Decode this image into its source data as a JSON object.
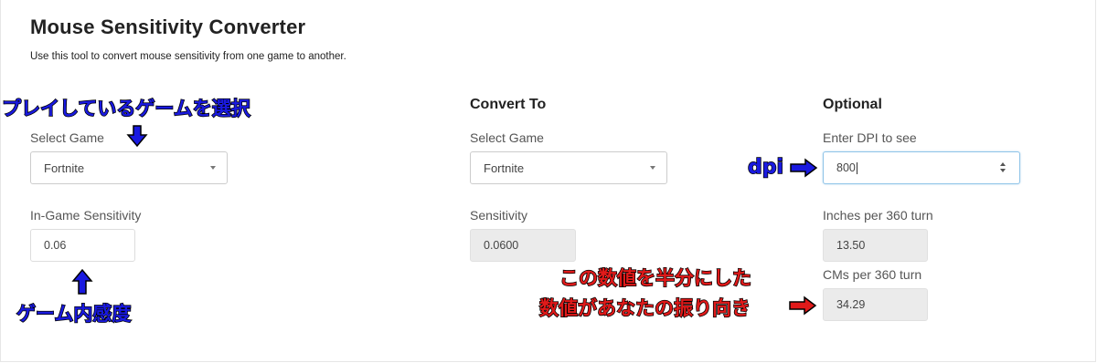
{
  "header": {
    "title": "Mouse Sensitivity Converter",
    "subtitle": "Use this tool to convert mouse sensitivity from one game to another."
  },
  "convert_from": {
    "select_label": "Select Game",
    "selected_game": "Fortnite",
    "sensitivity_label": "In-Game Sensitivity",
    "sensitivity_value": "0.06"
  },
  "convert_to": {
    "heading": "Convert To",
    "select_label": "Select Game",
    "selected_game": "Fortnite",
    "sensitivity_label": "Sensitivity",
    "sensitivity_value": "0.0600"
  },
  "optional": {
    "heading": "Optional",
    "dpi_label": "Enter DPI to see",
    "dpi_value": "800",
    "inches_label": "Inches per 360 turn",
    "inches_value": "13.50",
    "cms_label": "CMs per 360 turn",
    "cms_value": "34.29"
  },
  "annotations": {
    "select_game_note": "プレイしているゲームを選択",
    "sensitivity_note": "ゲーム内感度",
    "dpi_note": "dpi",
    "result_note_line1": "この数値を半分にした",
    "result_note_line2": "数値があなたの振り向き",
    "annotation_blue": "#1a1ae0",
    "annotation_red": "#e01a1a"
  },
  "icons": {
    "select_caret": "chevron-down-icon",
    "number_spinner": "spinner-icon",
    "annotation_arrow": "arrow-icon"
  }
}
